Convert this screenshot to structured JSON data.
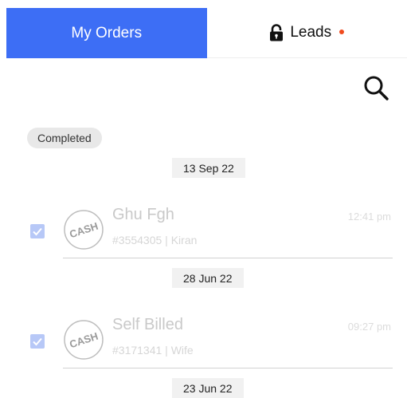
{
  "tabs": {
    "my_orders": "My Orders",
    "leads": "Leads"
  },
  "colors": {
    "accent": "#3d6ef5",
    "notification_dot": "#f04a1d"
  },
  "filter_chip": "Completed",
  "groups": [
    {
      "date": "13 Sep 22",
      "order": {
        "name": "Ghu Fgh",
        "details": "#3554305 | Kiran",
        "time": "12:41 pm",
        "payment": "CASH",
        "checked": true
      }
    },
    {
      "date": "28 Jun 22",
      "order": {
        "name": "Self Billed",
        "details": "#3171341 | Wife",
        "time": "09:27 pm",
        "payment": "CASH",
        "checked": true
      }
    },
    {
      "date": "23 Jun 22"
    }
  ],
  "icons": {
    "search": "search-icon",
    "lock": "unlock-icon",
    "payment": "cash-stamp-icon"
  }
}
